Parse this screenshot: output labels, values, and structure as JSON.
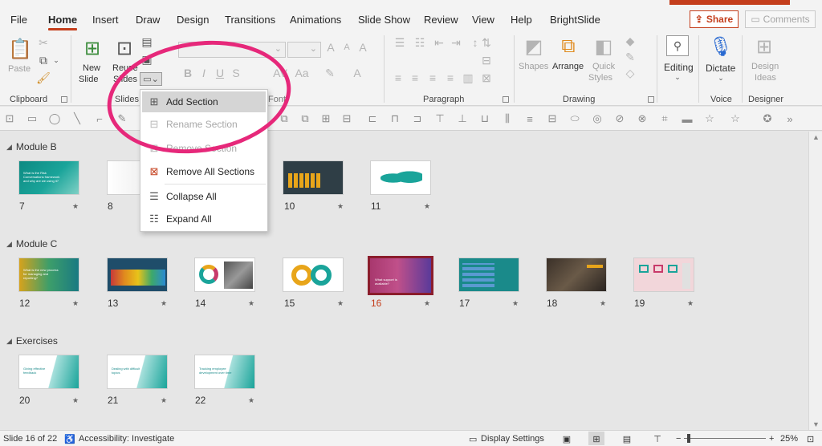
{
  "menu_tabs": [
    "File",
    "Home",
    "Insert",
    "Draw",
    "Design",
    "Transitions",
    "Animations",
    "Slide Show",
    "Review",
    "View",
    "Help",
    "BrightSlide"
  ],
  "active_tab": "Home",
  "share": {
    "label": "Share"
  },
  "comments": {
    "label": "Comments"
  },
  "ribbon": {
    "clipboard": {
      "label": "Clipboard",
      "paste": "Paste"
    },
    "slides": {
      "label": "Slides",
      "new_slide_l1": "New",
      "new_slide_l2": "Slide",
      "reuse_l1": "Reuse",
      "reuse_l2": "Slides"
    },
    "font": {
      "label": "Font"
    },
    "paragraph": {
      "label": "Paragraph"
    },
    "drawing": {
      "label": "Drawing",
      "shapes": "Shapes",
      "arrange": "Arrange",
      "quick_l1": "Quick",
      "quick_l2": "Styles"
    },
    "editing": {
      "label": "Editing"
    },
    "voice": {
      "label": "Voice",
      "dictate": "Dictate"
    },
    "designer": {
      "label": "Designer",
      "design_l1": "Design",
      "design_l2": "Ideas"
    }
  },
  "section_menu": {
    "items": [
      {
        "label": "Add Section",
        "enabled": true,
        "icon": "add-section-icon"
      },
      {
        "label": "Rename Section",
        "enabled": false,
        "icon": "rename-section-icon"
      },
      {
        "label": "Remove Section",
        "enabled": false,
        "icon": "remove-section-icon"
      },
      {
        "label": "Remove All Sections",
        "enabled": true,
        "icon": "remove-all-sections-icon"
      },
      {
        "label": "Collapse All",
        "enabled": true,
        "icon": "collapse-all-icon"
      },
      {
        "label": "Expand All",
        "enabled": true,
        "icon": "expand-all-icon"
      }
    ]
  },
  "sections": [
    {
      "name": "Module B",
      "slides": [
        {
          "number": "7",
          "title": "What is the Risk Conversations framework and why are we using it?"
        },
        {
          "number": "8",
          "title": ""
        },
        {
          "number": "10",
          "title": ""
        },
        {
          "number": "11",
          "title": ""
        }
      ]
    },
    {
      "name": "Module C",
      "slides": [
        {
          "number": "12",
          "title": "What is the new process for managing and reporting?"
        },
        {
          "number": "13",
          "title": ""
        },
        {
          "number": "14",
          "title": ""
        },
        {
          "number": "15",
          "title": ""
        },
        {
          "number": "16",
          "title": "What support is available?",
          "selected": true
        },
        {
          "number": "17",
          "title": ""
        },
        {
          "number": "18",
          "title": ""
        },
        {
          "number": "19",
          "title": ""
        }
      ]
    },
    {
      "name": "Exercises",
      "slides": [
        {
          "number": "20",
          "title": "Giving effective feedback"
        },
        {
          "number": "21",
          "title": "Dealing with difficult topics"
        },
        {
          "number": "22",
          "title": "Tracking employee development over time"
        }
      ]
    }
  ],
  "status": {
    "slide_info": "Slide 16 of 22",
    "accessibility": "Accessibility: Investigate",
    "display_settings": "Display Settings",
    "zoom": "25%",
    "zoom_fraction": 0.06
  },
  "colors": {
    "accent": "#c43e1c",
    "highlight": "#e6287a",
    "selected_border": "#8b1d2c",
    "teal": "#1aa49a"
  }
}
